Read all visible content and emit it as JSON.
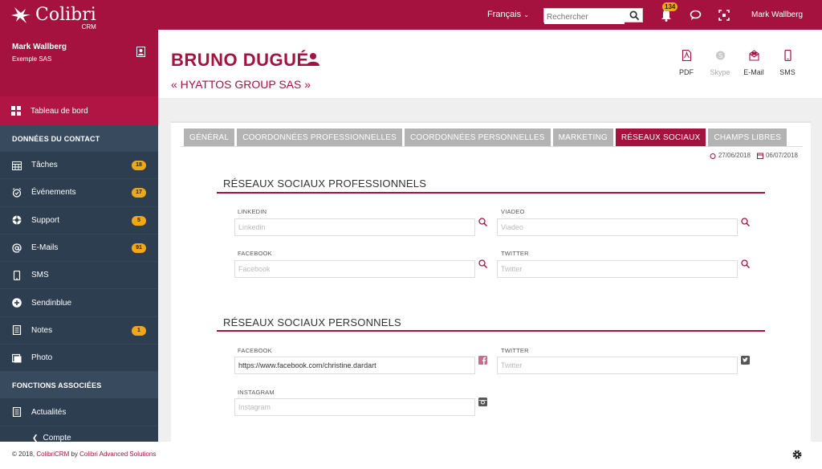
{
  "topbar": {
    "logo_name": "Colibri",
    "logo_sub": "CRM",
    "language": "Français",
    "search_placeholder": "Rechercher",
    "notifications_count": "134",
    "user_name": "Mark Wallberg",
    "icons": [
      "hummingbird-logo",
      "search-icon",
      "bell-icon",
      "chat-icon",
      "fullscreen-icon"
    ]
  },
  "sidebar": {
    "user_name": "Mark Wallberg",
    "user_company": "Exemple SAS",
    "dashboard_label": "Tableau de bord",
    "section_contact": "DONNÉES DU CONTACT",
    "items": [
      {
        "label": "Tâches",
        "badge": "18",
        "icon": "calendar-grid-icon"
      },
      {
        "label": "Événements",
        "badge": "17",
        "icon": "alarm-icon"
      },
      {
        "label": "Support",
        "badge": "5",
        "icon": "lifebuoy-icon"
      },
      {
        "label": "E-Mails",
        "badge": "91",
        "icon": "at-icon"
      },
      {
        "label": "SMS",
        "badge": "",
        "icon": "mobile-icon"
      },
      {
        "label": "Sendinblue",
        "badge": "",
        "icon": "plus-circle-icon"
      },
      {
        "label": "Notes",
        "badge": "1",
        "icon": "notes-icon"
      },
      {
        "label": "Photo",
        "badge": "",
        "icon": "photo-icon"
      }
    ],
    "section_functions": "FONCTIONS ASSOCIÉES",
    "news_label": "Actualités",
    "account_label": "Compte"
  },
  "header": {
    "contact_name": "BRUNO DUGUÉ",
    "company": "« HYATTOS GROUP SAS »",
    "actions": [
      {
        "label": "PDF",
        "icon": "pdf-icon",
        "enabled": true
      },
      {
        "label": "Skype",
        "icon": "skype-icon",
        "enabled": false
      },
      {
        "label": "E-Mail",
        "icon": "envelope-icon",
        "enabled": true
      },
      {
        "label": "SMS",
        "icon": "mobile-icon",
        "enabled": true
      }
    ]
  },
  "tabs": [
    "GÉNÉRAL",
    "COORDONNÉES PROFESSIONNELLES",
    "COORDONNÉES PERSONNELLES",
    "MARKETING",
    "RÉSEAUX SOCIAUX",
    "CHAMPS LIBRES"
  ],
  "active_tab": "RÉSEAUX SOCIAUX",
  "dates": {
    "created": "27/06/2018",
    "modified": "06/07/2018"
  },
  "professional": {
    "title": "RÉSEAUX SOCIAUX PROFESSIONNELS",
    "linkedin_label": "LINKEDIN",
    "linkedin_placeholder": "Linkedin",
    "linkedin_value": "",
    "viadeo_label": "VIADEO",
    "viadeo_placeholder": "Viadeo",
    "viadeo_value": "",
    "facebook_label": "FACEBOOK",
    "facebook_placeholder": "Facebook",
    "facebook_value": "",
    "twitter_label": "TWITTER",
    "twitter_placeholder": "Twitter",
    "twitter_value": ""
  },
  "personal": {
    "title": "RÉSEAUX SOCIAUX PERSONNELS",
    "facebook_label": "FACEBOOK",
    "facebook_placeholder": "Facebook",
    "facebook_value": "https://www.facebook.com/christine.dardart",
    "twitter_label": "TWITTER",
    "twitter_placeholder": "Twitter",
    "twitter_value": "",
    "instagram_label": "INSTAGRAM",
    "instagram_placeholder": "Instagram",
    "instagram_value": ""
  },
  "footer": {
    "prefix": "© 2018, ",
    "product": "ColibriCRM",
    "middle": " by ",
    "company": "Colibri Advanced Solutions"
  },
  "colors": {
    "brand": "#a5123f",
    "sidebar": "#2c3e50",
    "badge": "#f0a818",
    "tab_inactive": "#b3b3b3"
  }
}
